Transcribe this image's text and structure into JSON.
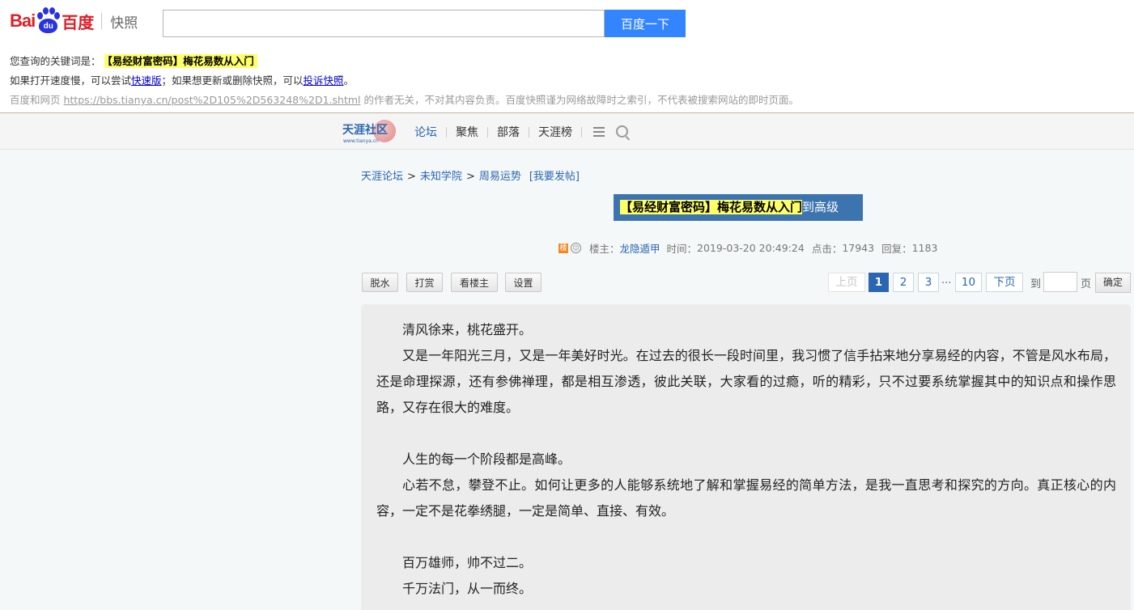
{
  "baidu": {
    "logo_bai": "Bai",
    "logo_du": "du",
    "logo_cn": "百度",
    "snapshot_label": "快照",
    "search_value": "",
    "search_button": "百度一下",
    "keyword_prefix": "您查询的关键词是：",
    "keyword": "【易经财富密码】梅花易数从入门",
    "line2_a": "如果打开速度慢，可以尝试",
    "line2_link1": "快速版",
    "line2_b": "；如果想更新或删除快照，可以",
    "line2_link2": "投诉快照",
    "line2_c": "。",
    "line3_a": "百度和网页 ",
    "line3_url": "https://bbs.tianya.cn/post%2D105%2D563248%2D1.shtml",
    "line3_b": " 的作者无关，不对其内容负责。百度快照谨为网络故障时之索引，不代表被搜索网站的即时页面。"
  },
  "tianya": {
    "logo_text": "天涯社区",
    "logo_sub": "www.tianya.cn",
    "nav": [
      "论坛",
      "聚焦",
      "部落",
      "天涯榜"
    ],
    "breadcrumb": [
      "天涯论坛",
      "未知学院",
      "周易运势"
    ],
    "breadcrumb_sep": ">",
    "post_link": "[我要发帖]",
    "title_highlight": "【易经财富密码】梅花易数从入门",
    "title_rest": "到高级",
    "meta": {
      "badge": "楼",
      "smile": "☺",
      "owner_label": "楼主：",
      "owner": "龙隐遁甲",
      "time_label": "时间：",
      "time": "2019-03-20 20:49:24",
      "clicks_label": "点击：",
      "clicks": "17943",
      "replies_label": "回复：",
      "replies": "1183"
    },
    "tools": [
      "脱水",
      "打赏",
      "看楼主",
      "设置"
    ],
    "pager": {
      "prev": "上页",
      "pages": [
        "1",
        "2",
        "3"
      ],
      "dots": "...",
      "last": "10",
      "next": "下页",
      "to": "到",
      "page_unit": "页",
      "confirm": "确定",
      "current": 1
    },
    "content": [
      "清风徐来，桃花盛开。",
      "又是一年阳光三月，又是一年美好时光。在过去的很长一段时间里，我习惯了信手拈来地分享易经的内容，不管是风水布局，还是命理探源，还有参佛禅理，都是相互渗透，彼此关联，大家看的过瘾，听的精彩，只不过要系统掌握其中的知识点和操作思路，又存在很大的难度。",
      "",
      "人生的每一个阶段都是高峰。",
      "心若不怠，攀登不止。如何让更多的人能够系统地了解和掌握易经的简单方法，是我一直思考和探究的方向。真正核心的内容，一定不是花拳绣腿，一定是简单、直接、有效。",
      "",
      "百万雄师，帅不过二。",
      "千万法门，从一而终。"
    ]
  },
  "colors": {
    "baidu_red": "#de1e26",
    "baidu_blue": "#2932e1",
    "search_button": "#3385ff",
    "tianya_blue": "#2a66b1",
    "highlight": "#ffff66"
  }
}
